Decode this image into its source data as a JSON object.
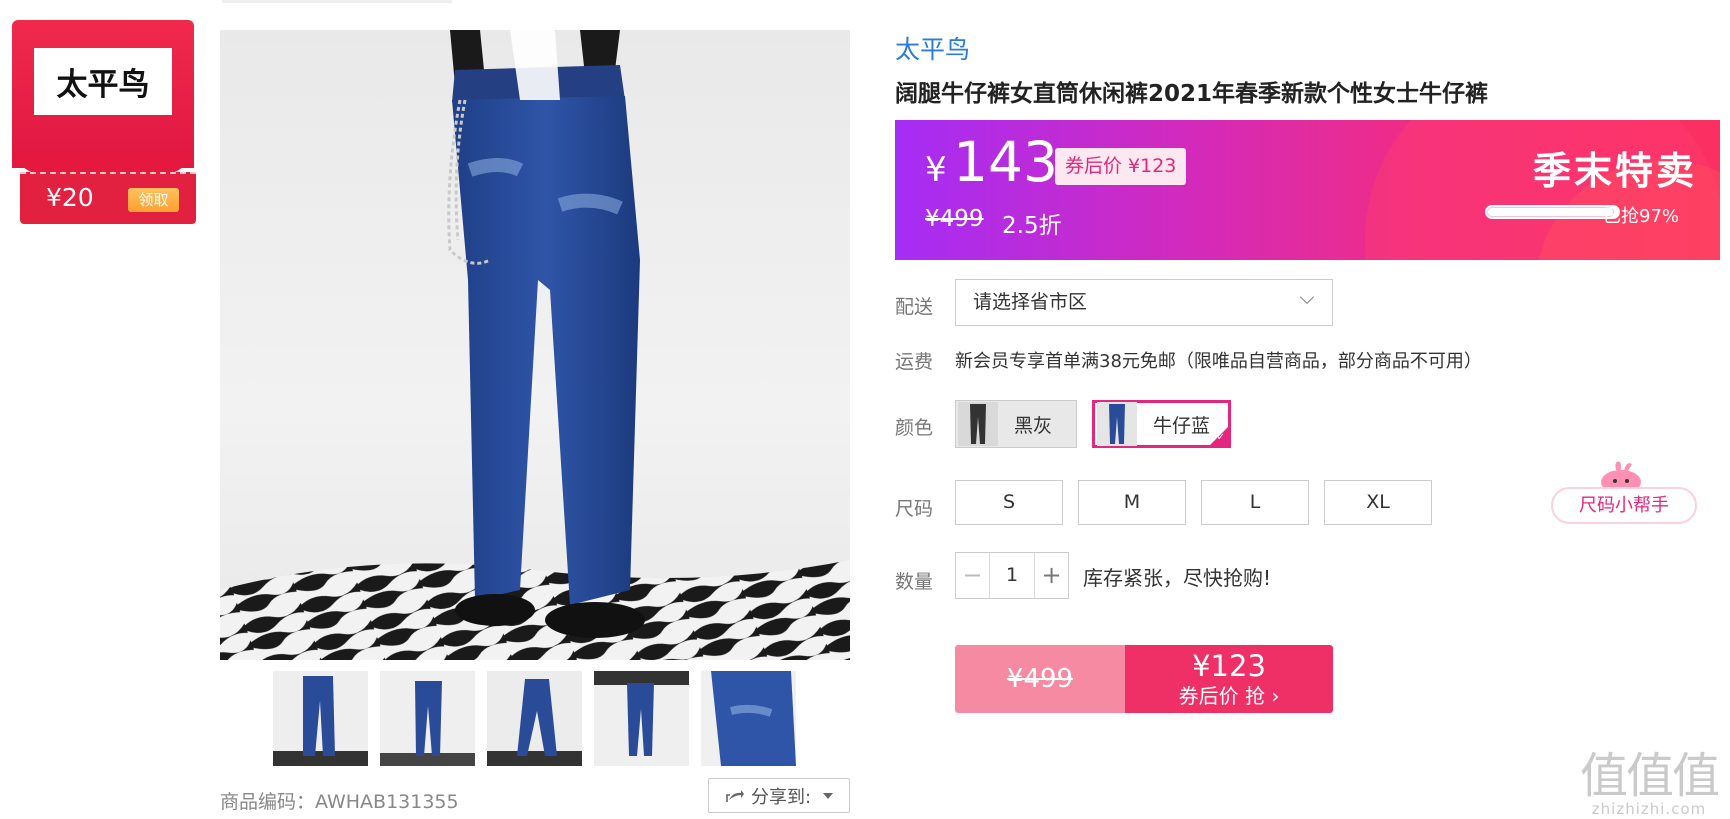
{
  "brand_card": {
    "logo_text": "太平鸟",
    "coupon_amount": "¥20",
    "coupon_button": "领取"
  },
  "gallery": {
    "main_image": "jeans-front-photo",
    "thumbnail_count": 5,
    "sku_label": "商品编码：AWHAB131355",
    "share_label": "分享到:"
  },
  "product": {
    "brand": "太平鸟",
    "title": "阔腿牛仔裤女直筒休闲裤2021年春季新款个性女士牛仔裤"
  },
  "price_banner": {
    "currency": "¥",
    "price": "143",
    "coupon_price": "券后价 ¥123",
    "original_price": "¥499",
    "discount": "2.5折",
    "promo_title": "季末特卖",
    "sold_text": "已抢97%",
    "sold_fraction": 0.97
  },
  "shipping": {
    "label": "配送",
    "placeholder": "请选择省市区"
  },
  "fee": {
    "label": "运费",
    "text": "新会员专享首单满38元免邮（限唯品自营商品，部分商品不可用）"
  },
  "colors": {
    "label": "颜色",
    "options": [
      "黑灰",
      "牛仔蓝"
    ],
    "selected": "牛仔蓝"
  },
  "sizes": {
    "label": "尺码",
    "options": [
      "S",
      "M",
      "L",
      "XL"
    ]
  },
  "quantity": {
    "label": "数量",
    "minus": "−",
    "value": "1",
    "plus": "+",
    "stock_text": "库存紧张，尽快抢购!"
  },
  "buy": {
    "original_price": "¥499",
    "price": "¥123",
    "cta": "券后价 抢 ›"
  },
  "size_helper": "尺码小帮手",
  "watermark": {
    "logo": "值值值",
    "url": "zhizhizhi.com"
  },
  "colors_theme": {
    "accent_pink": "#e5267e",
    "banner_purple": "#a52df5",
    "banner_red": "#fb2f60",
    "brand_red": "#e5193f",
    "link_blue": "#2a7cd8"
  }
}
